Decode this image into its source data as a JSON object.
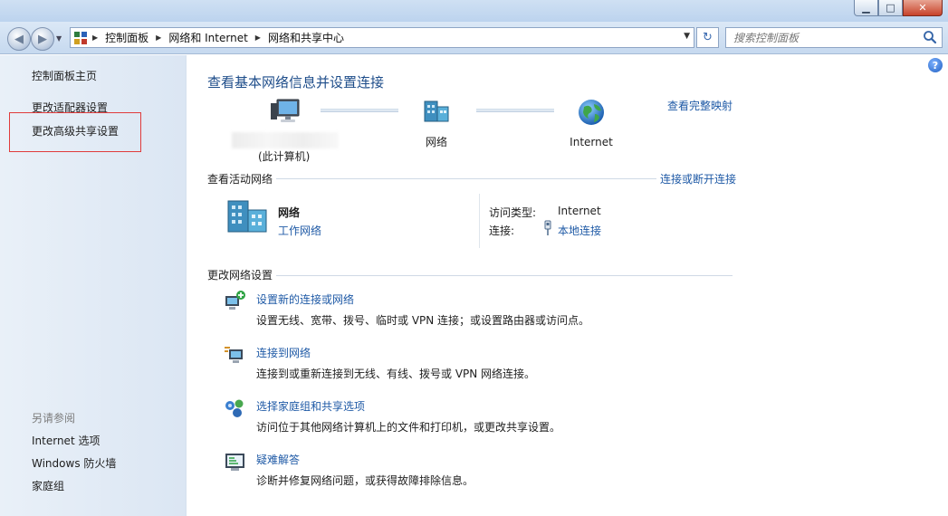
{
  "window": {
    "minimize_glyph": "▁",
    "maximize_glyph": "□",
    "close_glyph": "✕"
  },
  "nav": {
    "back_glyph": "◀",
    "forward_glyph": "▶",
    "breadcrumbs": [
      "控制面板",
      "网络和 Internet",
      "网络和共享中心"
    ],
    "breadcrumb_sep": "▶",
    "dropdown_glyph": "▼",
    "refresh_glyph": "↻",
    "search_placeholder": "搜索控制面板"
  },
  "sidebar": {
    "home": "控制面板主页",
    "adapter": "更改适配器设置",
    "advanced_sharing": "更改高级共享设置",
    "see_also_heading": "另请参阅",
    "see_also": [
      "Internet 选项",
      "Windows 防火墙",
      "家庭组"
    ]
  },
  "main": {
    "help_glyph": "?",
    "title": "查看基本网络信息并设置连接",
    "view_full_map": "查看完整映射",
    "map": {
      "pc_label": "(此计算机)",
      "network_label": "网络",
      "internet_label": "Internet"
    },
    "active_networks": {
      "heading": "查看活动网络",
      "toggle_link": "连接或断开连接",
      "network_name": "网络",
      "network_type": "工作网络",
      "access_type_label": "访问类型:",
      "access_type_value": "Internet",
      "connections_label": "连接:",
      "connections_value": "本地连接"
    },
    "change_settings": {
      "heading": "更改网络设置",
      "tasks": [
        {
          "link": "设置新的连接或网络",
          "desc": "设置无线、宽带、拨号、临时或 VPN 连接；或设置路由器或访问点。"
        },
        {
          "link": "连接到网络",
          "desc": "连接到或重新连接到无线、有线、拨号或 VPN 网络连接。"
        },
        {
          "link": "选择家庭组和共享选项",
          "desc": "访问位于其他网络计算机上的文件和打印机，或更改共享设置。"
        },
        {
          "link": "疑难解答",
          "desc": "诊断并修复网络问题，或获得故障排除信息。"
        }
      ]
    }
  },
  "colors": {
    "link": "#1f5aa6",
    "title": "#1e4d8a",
    "highlight_box": "#e03b3b"
  }
}
